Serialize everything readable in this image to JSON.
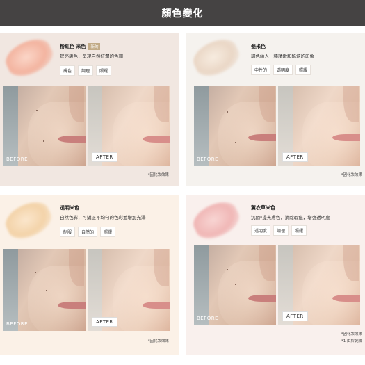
{
  "header": {
    "title": "顏色變化"
  },
  "cards": [
    {
      "title": "粉紅色 米色",
      "badge": "新的",
      "desc": "提亮膚色，呈現自然紅潤的色調",
      "tags": [
        "膚色",
        "調理",
        "照耀"
      ],
      "before_label": "BEFORE",
      "after_label": "AFTER",
      "footnote": "*因化妝效果",
      "swatch_color": "#f3b4a0"
    },
    {
      "title": "瓷米色",
      "desc": "調色給人一種精緻和酷炫的印象",
      "tags": [
        "中性的",
        "透明度",
        "照耀"
      ],
      "before_label": "BEFORE",
      "after_label": "AFTER",
      "footnote": "*因化妝效果",
      "swatch_color": "#ead7c6"
    },
    {
      "title": "透明米色",
      "desc": "自然色彩，可矯正不均勻的色彩並增加光澤",
      "tags": [
        "制服",
        "自然的",
        "照耀"
      ],
      "before_label": "BEFORE",
      "after_label": "AFTER",
      "footnote": "*因化妝效果",
      "swatch_color": "#f3d3a9"
    },
    {
      "title": "薰衣草米色",
      "desc": "沉悶*提亮膚色，消除瑕疵，增強透明度",
      "tags": [
        "透明度",
        "調理",
        "照耀"
      ],
      "before_label": "BEFORE",
      "after_label": "AFTER",
      "footnote": "*因化妝效果",
      "footnote2": "*1 由於乾燥",
      "swatch_color": "#f0b7b6"
    }
  ]
}
